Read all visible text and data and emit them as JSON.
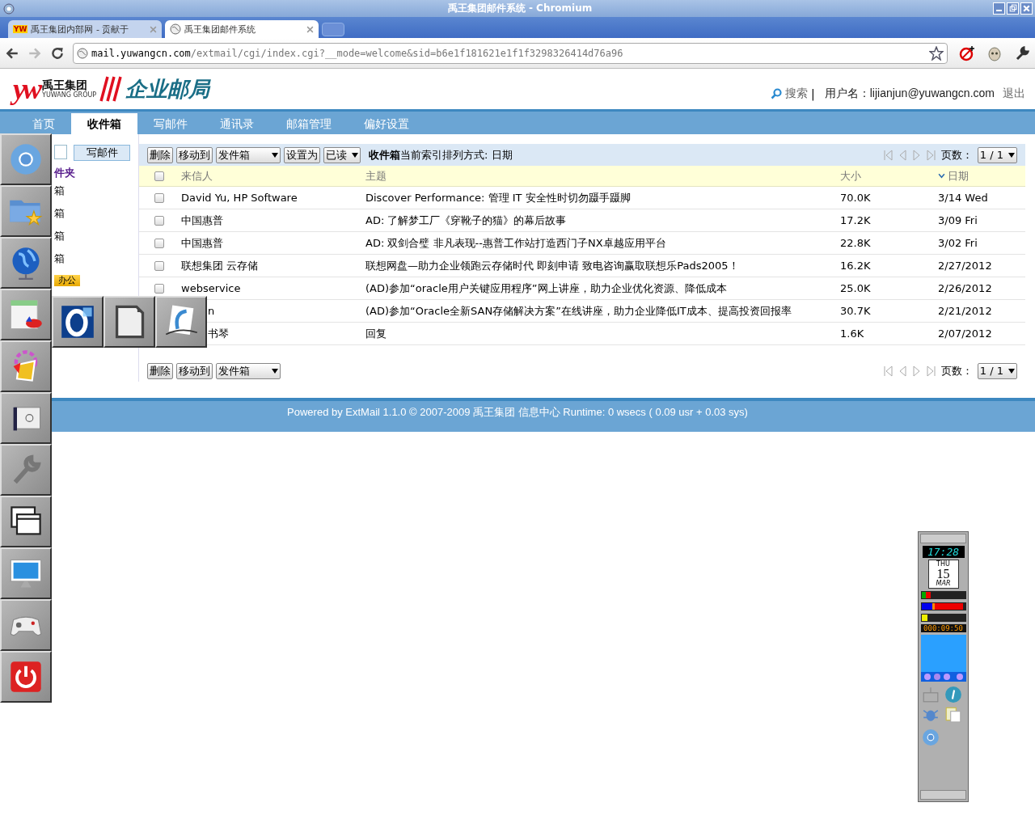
{
  "window": {
    "title": "禹王集团邮件系统 - Chromium"
  },
  "tabs": [
    {
      "label": "禹王集团内部网 - 贡献于",
      "favicon": "YW",
      "selected": false
    },
    {
      "label": "禹王集团邮件系统",
      "selected": true
    }
  ],
  "address": {
    "host": "mail.yuwangcn.com",
    "path": "/extmail/cgi/index.cgi?__mode=welcome&sid=b6e1f181621e1f1f3298326414d76a96"
  },
  "logo": {
    "mark": "yw",
    "name": "禹王集团",
    "group": "YUWANG GROUP",
    "product": "企业邮局"
  },
  "header": {
    "search": "搜索",
    "separator": "|",
    "user": "用户名：lijianjun@yuwangcn.com",
    "logout": "退出"
  },
  "nav": [
    {
      "label": "首页",
      "selected": false
    },
    {
      "label": "收件箱",
      "selected": true
    },
    {
      "label": "写邮件",
      "selected": false
    },
    {
      "label": "通讯录",
      "selected": false
    },
    {
      "label": "邮箱管理",
      "selected": false
    },
    {
      "label": "偏好设置",
      "selected": false
    }
  ],
  "sidebar": {
    "compose": "写邮件",
    "folders_title": "件夹",
    "folders": [
      "箱",
      "箱",
      "箱",
      "箱"
    ],
    "badge": "办公"
  },
  "toolbar": {
    "delete": "删除",
    "move": "移动到",
    "move_target": "发件箱",
    "set": "设置为",
    "set_value": "已读",
    "summary": "**收件箱**当前索引排列方式: 日期",
    "pages_label": "页数：",
    "page": "1 / 1"
  },
  "table": {
    "select_all": {
      "checked": false
    },
    "columns": [
      "来信人",
      "主题",
      "大小",
      "日期"
    ],
    "rows": [
      {
        "checked": false,
        "kind": "full",
        "sender": "David Yu, HP Software",
        "subject": "Discover Performance: 管理 IT 安全性时切勿蹑手蹑脚",
        "size": "70.0K",
        "date": "3/14 Wed"
      },
      {
        "checked": false,
        "kind": "full",
        "sender": "中国惠普",
        "subject": "AD: 了解梦工厂《穿靴子的猫》的幕后故事",
        "size": "17.2K",
        "date": "3/09 Fri"
      },
      {
        "checked": false,
        "kind": "full",
        "sender": "中国惠普",
        "subject": "AD: 双剑合璧 非凡表现--惠普工作站打造西门子NX卓越应用平台",
        "size": "22.8K",
        "date": "3/02 Fri"
      },
      {
        "checked": false,
        "kind": "full",
        "sender": "联想集团 云存储",
        "subject": "联想网盘—助力企业领跑云存储时代 即刻申请 致电咨询赢取联想乐Pads2005！",
        "size": "16.2K",
        "date": "2/27/2012"
      },
      {
        "checked": false,
        "kind": "full",
        "sender": "webservice",
        "subject": "(AD)参加“oracle用户关键应用程序”网上讲座，助力企业优化资源、降低成本",
        "size": "25.0K",
        "date": "2/26/2012"
      },
      {
        "kind": "covered",
        "sender": "n",
        "subject": "(AD)参加“Oracle全新SAN存储解决方案”在线讲座，助力企业降低IT成本、提高投资回报率",
        "size": "30.7K",
        "date": "2/21/2012"
      },
      {
        "kind": "covered",
        "sender": "书琴",
        "subject": "回复",
        "size": "1.6K",
        "date": "2/07/2012"
      }
    ]
  },
  "bottom_toolbar": {
    "delete": "删除",
    "move": "移动到",
    "move_target": "发件箱",
    "pages_label": "页数：",
    "page": "1 / 1"
  },
  "footer": "Powered by ExtMail 1.1.0 © 2007-2009 禹王集团 信息中心 Runtime: 0 wsecs ( 0.09 usr + 0.03 sys)",
  "dock_widget": {
    "time": "17:28",
    "weekday": "THU",
    "day": "15",
    "month": "MAR",
    "uptime": "000:09:50"
  }
}
